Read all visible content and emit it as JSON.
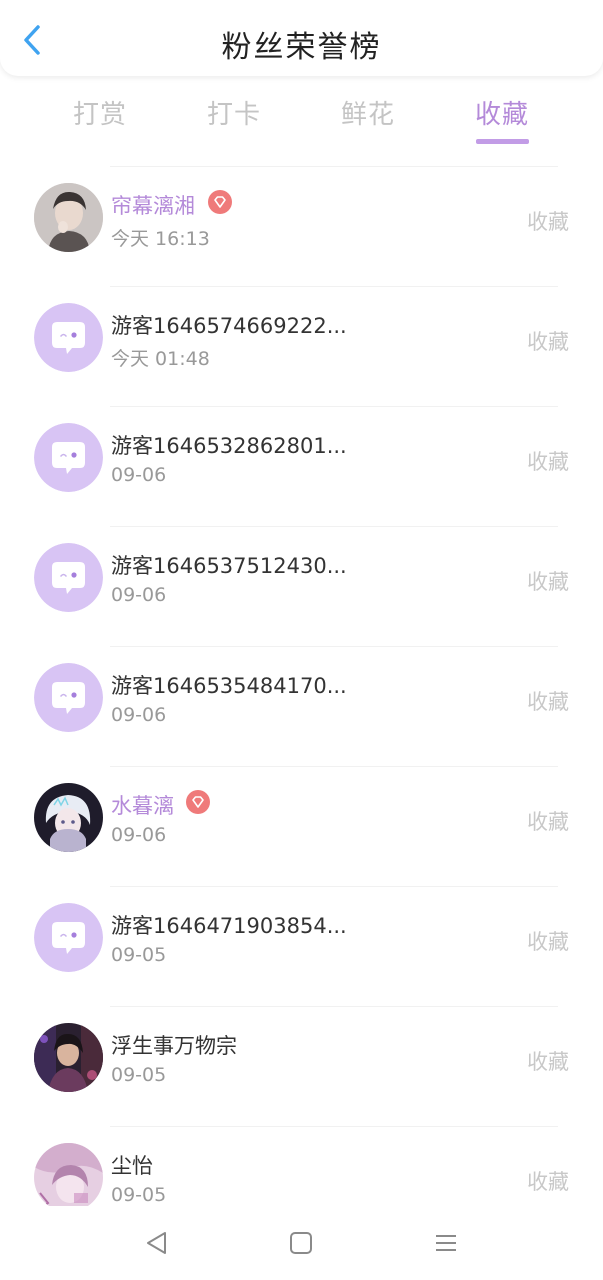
{
  "header": {
    "title": "粉丝荣誉榜",
    "back_icon": "chevron-left-icon",
    "accent": "#3fa3f0"
  },
  "tabs": [
    {
      "label": "打赏",
      "active": false
    },
    {
      "label": "打卡",
      "active": false
    },
    {
      "label": "鲜花",
      "active": false
    },
    {
      "label": "收藏",
      "active": true
    }
  ],
  "colors": {
    "active_tab": "#b48ad9",
    "inactive_tab": "#c4c4c4",
    "vip_name": "#b48ad9",
    "badge": "#ef7a7a",
    "guest_avatar_bg": "#d8c4f4"
  },
  "fans": [
    {
      "name": "帘幕漓湘",
      "time": "今天 16:13",
      "action": "收藏",
      "vip": true,
      "avatar": "photo-boy"
    },
    {
      "name": "游客1646574669222...",
      "time": "今天 01:48",
      "action": "收藏",
      "vip": false,
      "avatar": "guest"
    },
    {
      "name": "游客1646532862801...",
      "time": "09-06",
      "action": "收藏",
      "vip": false,
      "avatar": "guest"
    },
    {
      "name": "游客1646537512430...",
      "time": "09-06",
      "action": "收藏",
      "vip": false,
      "avatar": "guest"
    },
    {
      "name": "游客1646535484170...",
      "time": "09-06",
      "action": "收藏",
      "vip": false,
      "avatar": "guest"
    },
    {
      "name": "水暮漓",
      "time": "09-06",
      "action": "收藏",
      "vip": true,
      "avatar": "anime-white-hair"
    },
    {
      "name": "游客1646471903854...",
      "time": "09-05",
      "action": "收藏",
      "vip": false,
      "avatar": "guest"
    },
    {
      "name": "浮生事万物宗",
      "time": "09-05",
      "action": "收藏",
      "vip": false,
      "avatar": "game-character"
    },
    {
      "name": "尘怡",
      "time": "09-05",
      "action": "收藏",
      "vip": false,
      "avatar": "pink-illustration"
    }
  ],
  "bottom_nav": {
    "back": "triangle-back-icon",
    "home": "square-home-icon",
    "menu": "hamburger-menu-icon"
  }
}
